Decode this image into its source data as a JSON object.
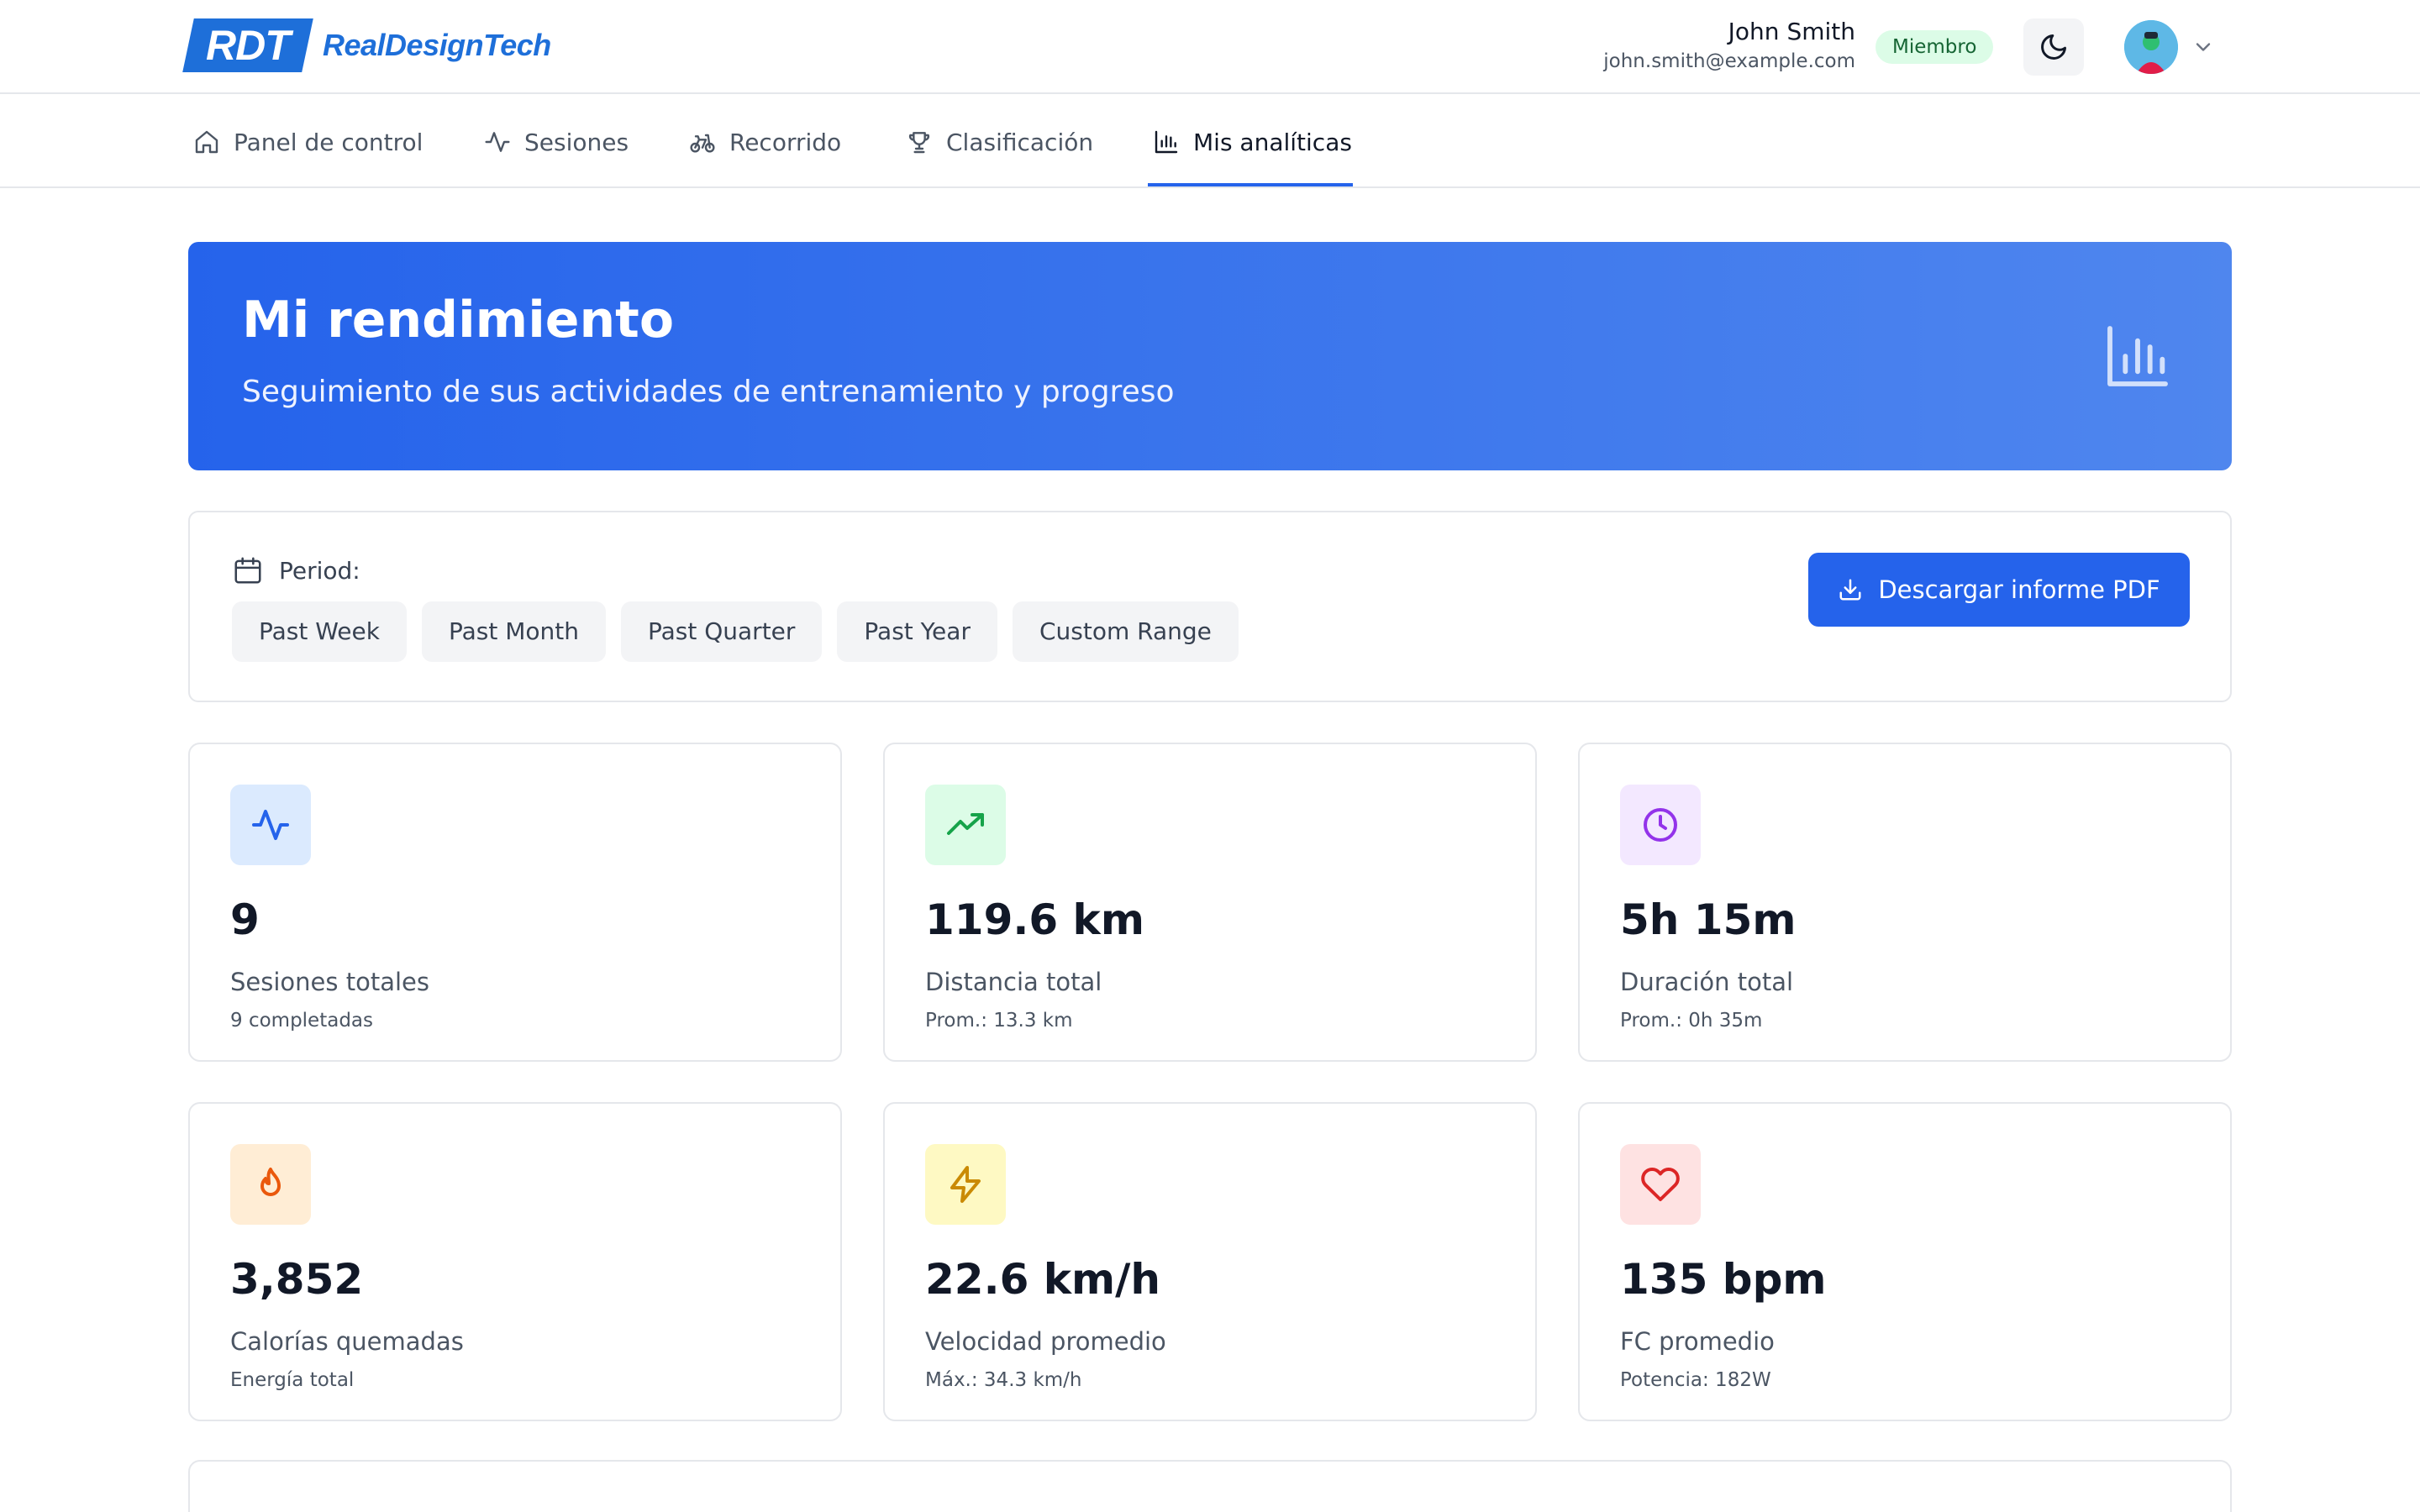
{
  "brand": {
    "mark": "RDT",
    "name": "RealDesignTech"
  },
  "user": {
    "name": "John Smith",
    "email": "john.smith@example.com",
    "role": "Miembro"
  },
  "nav": {
    "items": [
      {
        "label": "Panel de control",
        "icon": "home-icon"
      },
      {
        "label": "Sesiones",
        "icon": "activity-icon"
      },
      {
        "label": "Recorrido",
        "icon": "bike-icon"
      },
      {
        "label": "Clasificación",
        "icon": "trophy-icon"
      },
      {
        "label": "Mis analíticas",
        "icon": "bar-chart-icon",
        "active": true
      }
    ]
  },
  "hero": {
    "title": "Mi rendimiento",
    "subtitle": "Seguimiento de sus actividades de entrenamiento y progreso",
    "icon": "bar-chart-icon"
  },
  "filters": {
    "period_label": "Period:",
    "periods": [
      "Past Week",
      "Past Month",
      "Past Quarter",
      "Past Year",
      "Custom Range"
    ],
    "download_label": "Descargar informe PDF"
  },
  "stats": [
    {
      "value": "9",
      "label": "Sesiones totales",
      "sub": "9 completadas",
      "icon": "activity-icon",
      "color": "#2563eb",
      "bg": "#dbeafe"
    },
    {
      "value": "119.6 km",
      "label": "Distancia total",
      "sub": "Prom.: 13.3 km",
      "icon": "trending-up-icon",
      "color": "#16a34a",
      "bg": "#dcfce7"
    },
    {
      "value": "5h 15m",
      "label": "Duración total",
      "sub": "Prom.: 0h 35m",
      "icon": "clock-icon",
      "color": "#9333ea",
      "bg": "#f3e8ff"
    },
    {
      "value": "3,852",
      "label": "Calorías quemadas",
      "sub": "Energía total",
      "icon": "flame-icon",
      "color": "#ea580c",
      "bg": "#ffedd5"
    },
    {
      "value": "22.6 km/h",
      "label": "Velocidad promedio",
      "sub": "Máx.: 34.3 km/h",
      "icon": "zap-icon",
      "color": "#ca8a04",
      "bg": "#fef9c3"
    },
    {
      "value": "135 bpm",
      "label": "FC promedio",
      "sub": "Potencia: 182W",
      "icon": "heart-icon",
      "color": "#dc2626",
      "bg": "#fee2e2"
    }
  ]
}
